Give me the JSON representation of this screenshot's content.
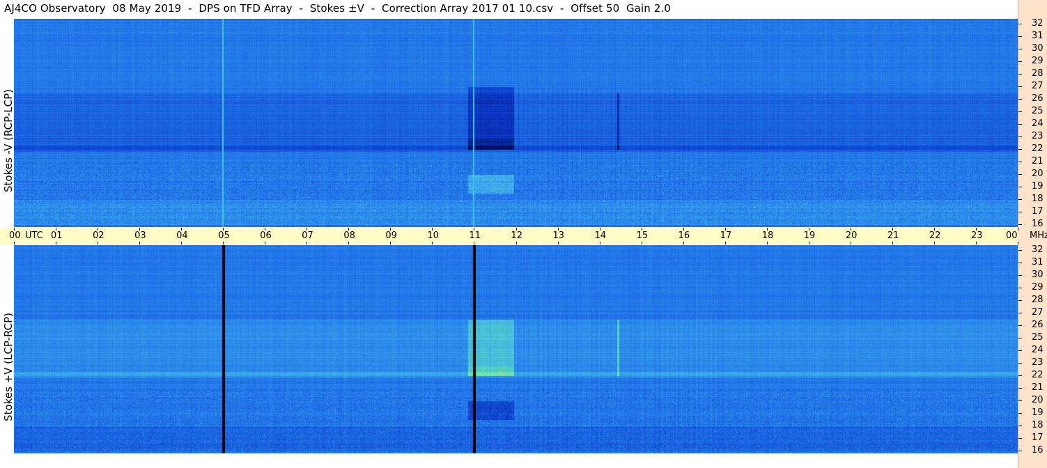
{
  "title": "AJ4CO Observatory  08 May 2019  -  DPS on TFD Array  -  Stokes ±V  -  Correction Array 2017 01 10.csv  -  Offset 50  Gain 2.0",
  "colors": {
    "background": "#ffffff",
    "time_axis_band": "#fffcc8",
    "freq_axis_band": "#fde3cc",
    "colormap": [
      "#000a50",
      "#0a37c8",
      "#1e6ee6",
      "#3caaf0",
      "#64e6aa",
      "#e6f050",
      "#f03c28"
    ]
  },
  "time_axis": {
    "labels": [
      "00",
      "01",
      "02",
      "03",
      "04",
      "05",
      "06",
      "07",
      "08",
      "09",
      "10",
      "11",
      "12",
      "13",
      "14",
      "15",
      "16",
      "17",
      "18",
      "19",
      "20",
      "21",
      "22",
      "23",
      "00"
    ],
    "unit_left": "UTC",
    "unit_right": "MHz"
  },
  "chart_data": [
    {
      "type": "heatmap",
      "panel": "top",
      "ylabel": "Stokes -V (RCP-LCP)",
      "x_range_utc_hours": [
        0,
        24
      ],
      "y_range_mhz": [
        15.8,
        32.4
      ],
      "y_ticks": [
        "16",
        "17",
        "18",
        "19",
        "20",
        "21",
        "22",
        "23",
        "24",
        "25",
        "26",
        "27",
        "28",
        "29",
        "30",
        "31",
        "32"
      ],
      "bright_vertical_lines_utc": [
        5.0,
        11.0
      ],
      "burst_region": {
        "utc": [
          10.85,
          11.95
        ],
        "mhz": [
          22.0,
          27.0
        ],
        "level": "dark"
      },
      "burst_low_band": {
        "utc": [
          10.85,
          11.95
        ],
        "mhz": [
          18.5,
          20.0
        ],
        "level": "bright"
      },
      "features": [
        {
          "utc": [
            0.0,
            24.0
          ],
          "mhz": [
            22.0,
            26.5
          ],
          "level": "dark"
        },
        {
          "utc": [
            0.0,
            24.0
          ],
          "mhz": [
            16.0,
            18.0
          ],
          "level": "bright"
        },
        {
          "utc": [
            14.42,
            14.46
          ],
          "mhz": [
            22.0,
            26.5
          ],
          "level": "dark"
        }
      ]
    },
    {
      "type": "heatmap",
      "panel": "bottom",
      "ylabel": "Stokes +V (LCP-RCP)",
      "x_range_utc_hours": [
        0,
        24
      ],
      "y_range_mhz": [
        15.8,
        32.4
      ],
      "y_ticks": [
        "16",
        "17",
        "18",
        "19",
        "20",
        "21",
        "22",
        "23",
        "24",
        "25",
        "26",
        "27",
        "28",
        "29",
        "30",
        "31",
        "32"
      ],
      "dark_vertical_lines_utc": [
        5.0,
        11.0
      ],
      "burst_region": {
        "utc": [
          10.85,
          11.95
        ],
        "mhz": [
          22.0,
          26.5
        ],
        "level": "bright"
      },
      "burst_low_band": {
        "utc": [
          10.85,
          11.95
        ],
        "mhz": [
          18.5,
          20.0
        ],
        "level": "dark"
      },
      "features": [
        {
          "utc": [
            0.0,
            24.0
          ],
          "mhz": [
            22.0,
            26.5
          ],
          "level": "bright"
        },
        {
          "utc": [
            0.0,
            24.0
          ],
          "mhz": [
            16.0,
            18.0
          ],
          "level": "dark"
        },
        {
          "utc": [
            14.42,
            14.46
          ],
          "mhz": [
            22.0,
            26.5
          ],
          "level": "bright"
        }
      ]
    }
  ]
}
